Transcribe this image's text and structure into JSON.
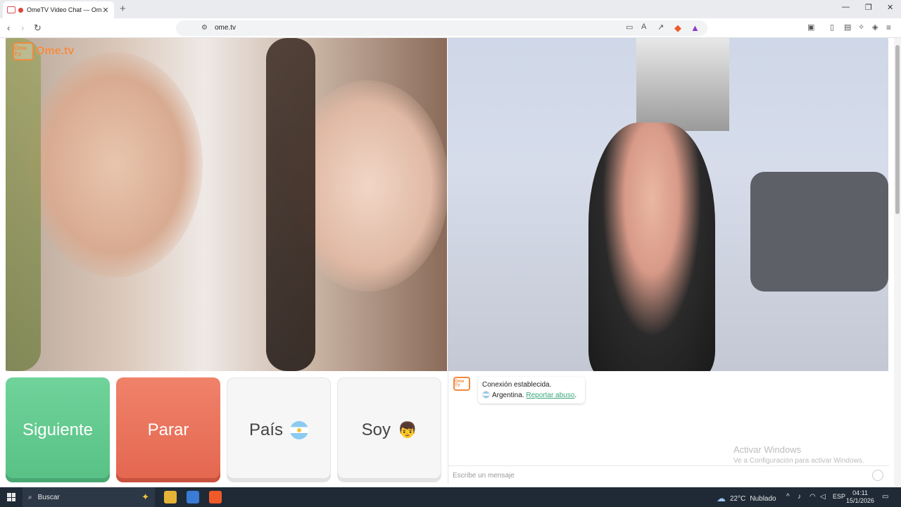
{
  "browser": {
    "tab_title": "OmeTV Video Chat — Omeg",
    "tab_close": "✕",
    "new_tab": "+",
    "url": "ome.tv",
    "window_controls": [
      "—",
      "❐",
      "✕"
    ]
  },
  "logo": {
    "badge": "Ome TV",
    "name": "Ome.tv"
  },
  "controls": {
    "next_label": "Siguiente",
    "stop_label": "Parar",
    "country_label": "País",
    "me_label": "Soy"
  },
  "chat": {
    "logo_badge": "Ome TV",
    "status": "Conexión establecida.",
    "country": "Argentina.",
    "report_link": "Reportar abuso",
    "input_placeholder": "Escribe un mensaje"
  },
  "watermark": {
    "title": "Activar Windows",
    "subtitle": "Ve a Configuración para activar Windows."
  },
  "taskbar": {
    "search_label": "Buscar",
    "weather_temp": "22°C",
    "weather_desc": "Nublado",
    "language": "ESP",
    "time": "04:11",
    "date": "15/1/2026"
  },
  "colors": {
    "next": "#58c185",
    "stop": "#e4664f",
    "brand": "#f08a3e",
    "link": "#3aa67a"
  },
  "icons": {
    "flag": "argentina-flag-icon",
    "me": "boy-emoji-icon"
  }
}
